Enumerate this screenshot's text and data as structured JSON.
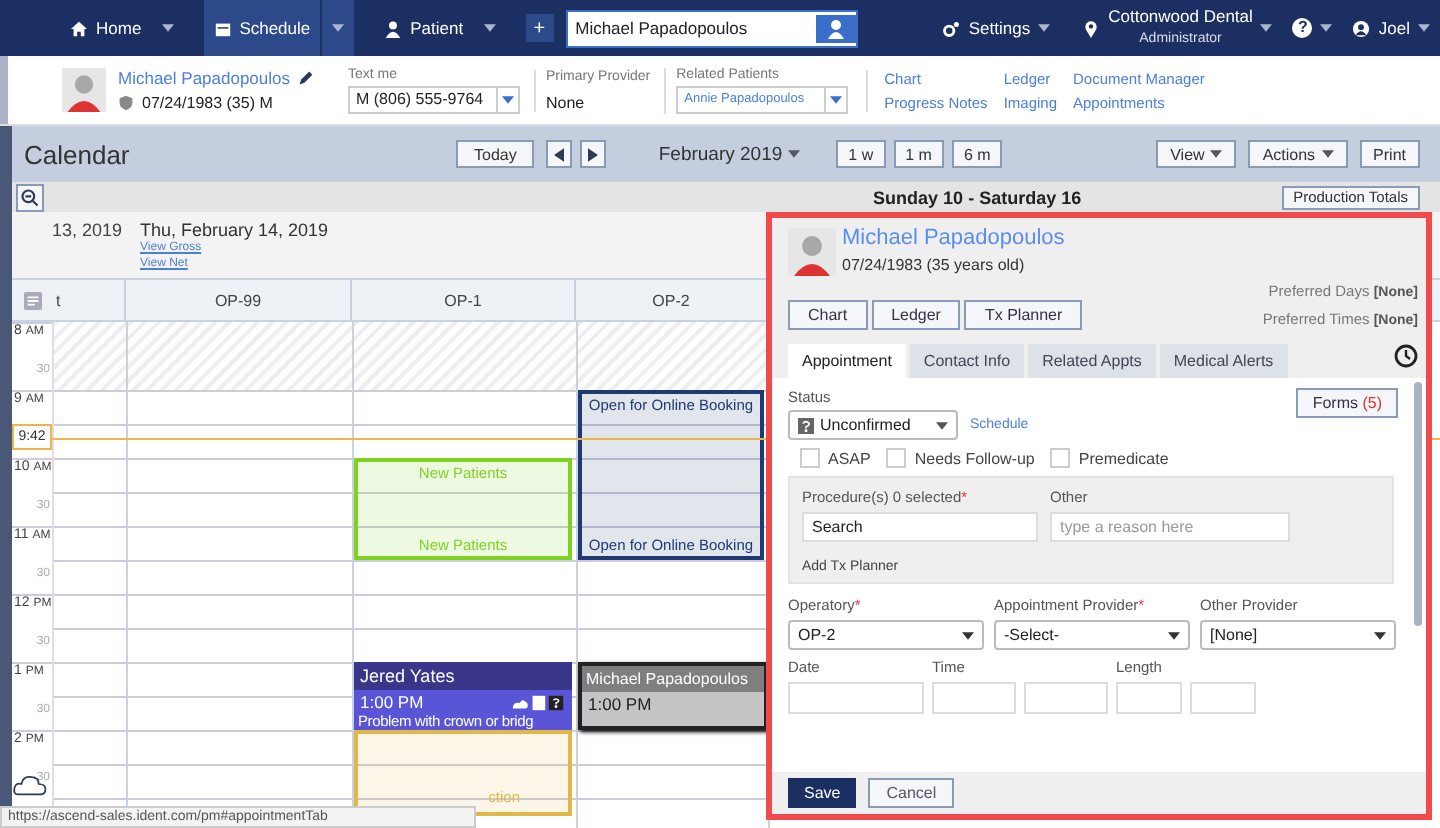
{
  "nav": {
    "items": [
      {
        "label": "Home",
        "kind": "home",
        "selected": false
      },
      {
        "label": "Schedule",
        "kind": "schedule",
        "selected": true
      },
      {
        "label": "Patient",
        "kind": "patient",
        "selected": false
      }
    ],
    "add_label": "+",
    "search": {
      "value": "Michael Papadopoulos"
    },
    "settings": "Settings",
    "office": {
      "name": "Cottonwood Dental",
      "role": "Administrator"
    },
    "help": "?",
    "user": "Joel"
  },
  "patient_header": {
    "name": "Michael Papadopoulos",
    "details": "07/24/1983 (35) M",
    "text_me": {
      "label": "Text me",
      "value": "M (806) 555-9764"
    },
    "primary_provider": {
      "label": "Primary Provider",
      "value": "None"
    },
    "related_patients": {
      "label": "Related Patients",
      "value": "Annie Papadopoulos"
    },
    "links": [
      [
        "Chart",
        "Progress Notes"
      ],
      [
        "Ledger",
        "Imaging"
      ],
      [
        "Document Manager",
        "Appointments"
      ]
    ]
  },
  "calendar": {
    "title": "Calendar",
    "today": "Today",
    "month": "February 2019",
    "ranges": [
      "1 w",
      "1 m",
      "6 m"
    ],
    "actions": [
      "View",
      "Actions",
      "Print"
    ],
    "week": "Sunday 10 - Saturday 16",
    "production_totals": "Production Totals",
    "previous_day": "13, 2019",
    "day": "Thu, February 14, 2019",
    "day_links": [
      "View Gross",
      "View Net"
    ],
    "times": [
      {
        "hour": "8",
        "period": "AM",
        "half": "30"
      },
      {
        "hour": "9",
        "period": "AM"
      },
      {
        "hour": "10",
        "period": "AM",
        "half": "30"
      },
      {
        "hour": "11",
        "period": "AM",
        "half": "30"
      },
      {
        "hour": "12",
        "period": "PM",
        "half": "30"
      },
      {
        "hour": "1",
        "period": "PM",
        "half": "30"
      },
      {
        "hour": "2",
        "period": "PM",
        "half": "30"
      }
    ],
    "now": "9:42",
    "columns": [
      {
        "label": "t"
      },
      {
        "label": "OP-99"
      },
      {
        "label": "OP-1",
        "appointments": [
          {
            "kind": "block",
            "color": "#7ed321",
            "top_label": "New Patients",
            "bottom_label": "New Patients"
          },
          {
            "kind": "appointment",
            "color": "#5a55d6",
            "name": "Jered Yates",
            "time": "1:00 PM",
            "reason": "Problem with crown or bridg",
            "selected": false
          },
          {
            "kind": "block",
            "color": "#e0b84a",
            "bottom_label": "ction"
          }
        ]
      },
      {
        "label": "OP-2",
        "appointments": [
          {
            "kind": "block",
            "color": "#1f3a73",
            "top_label": "Open for Online Booking",
            "bottom_label": "Open for Online Booking"
          },
          {
            "kind": "appointment",
            "color": "#c4c4c4",
            "name": "Michael Papadopoulos",
            "time": "1:00 PM",
            "selected": true
          }
        ]
      }
    ]
  },
  "status_url": "https://ascend-sales.ident.com/pm#appointmentTab",
  "popup": {
    "name": "Michael Papadopoulos",
    "details": "07/24/1983 (35 years old)",
    "preferred": [
      {
        "label": "Preferred Days",
        "value": "[None]"
      },
      {
        "label": "Preferred Times",
        "value": "[None]"
      }
    ],
    "buttons": [
      "Chart",
      "Ledger",
      "Tx Planner"
    ],
    "tabs": [
      {
        "label": "Appointment",
        "selected": true
      },
      {
        "label": "Contact Info",
        "selected": false
      },
      {
        "label": "Related Appts",
        "selected": false
      },
      {
        "label": "Medical Alerts",
        "selected": false
      }
    ],
    "status": {
      "label": "Status",
      "value": "Unconfirmed"
    },
    "schedule_link": "Schedule",
    "forms": {
      "label": "Forms",
      "count": "(5)"
    },
    "checkboxes": [
      {
        "label": "ASAP",
        "checked": false
      },
      {
        "label": "Needs Follow-up",
        "checked": false
      },
      {
        "label": "Premedicate",
        "checked": false
      }
    ],
    "procedures": {
      "label": "Procedure(s) 0 selected",
      "required_mark": "*",
      "value": "Search"
    },
    "other": {
      "label": "Other",
      "placeholder": "type a reason here"
    },
    "add_tx": "Add Tx Planner",
    "selects": [
      {
        "label": "Operatory",
        "required_mark": "*",
        "value": "OP-2"
      },
      {
        "label": "Appointment Provider",
        "required_mark": "*",
        "value": "-Select-"
      },
      {
        "label": "Other Provider",
        "value": "[None]"
      }
    ],
    "date_labels": [
      "Date",
      "Time",
      "Length"
    ],
    "save": "Save",
    "cancel": "Cancel"
  }
}
